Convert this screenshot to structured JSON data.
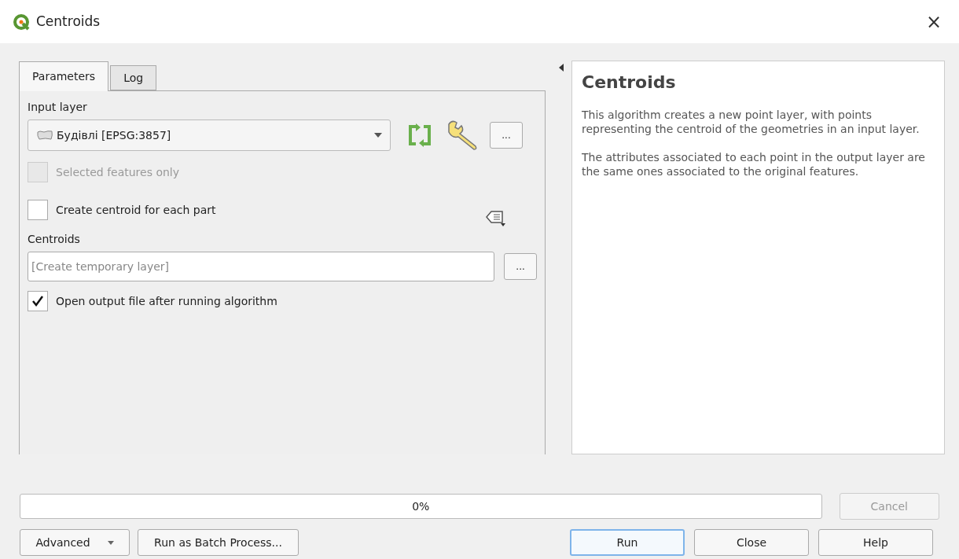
{
  "window": {
    "title": "Centroids",
    "close": "×"
  },
  "tabs": [
    {
      "label": "Parameters",
      "selected": true
    },
    {
      "label": "Log",
      "selected": false
    }
  ],
  "parameters": {
    "input_layer": {
      "label": "Input layer",
      "value": "Будівлі [EPSG:3857]",
      "more": "..."
    },
    "options": [
      {
        "label": "Selected features only",
        "checked": false,
        "disabled": true
      },
      {
        "label": "Create centroid for each part",
        "checked": false,
        "disabled": false
      }
    ],
    "output": {
      "label": "Centroids",
      "placeholder": "[Create temporary layer]",
      "more": "..."
    },
    "open_output": {
      "label": "Open output file after running algorithm",
      "checked": true,
      "disabled": false
    }
  },
  "help": {
    "title": "Centroids",
    "paragraphs": [
      "This algorithm creates a new point layer, with points representing the centroid of the geometries in an input layer.",
      "The attributes associated to each point in the output layer are the same ones associated to the original features."
    ]
  },
  "progress": {
    "level": 0,
    "reading": "0%"
  },
  "cancel": {
    "label": "Cancel",
    "disabled": true
  },
  "buttons": [
    {
      "label": "Advanced",
      "kind": "menu",
      "focused": false
    },
    {
      "label": "Run as Batch Process...",
      "kind": "plain",
      "focused": false
    },
    {
      "label": "Run",
      "kind": "plain",
      "focused": true
    },
    {
      "label": "Close",
      "kind": "plain",
      "focused": false
    },
    {
      "label": "Help",
      "kind": "plain",
      "focused": false
    }
  ]
}
